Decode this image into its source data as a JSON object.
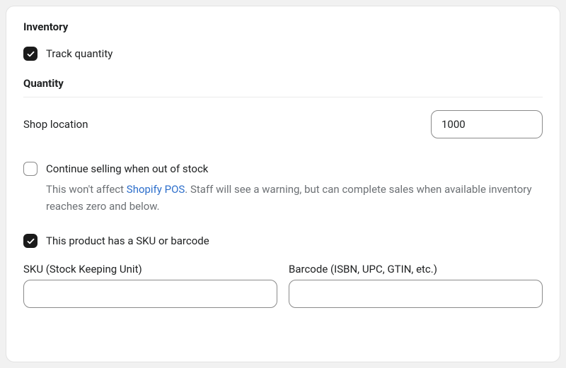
{
  "section": {
    "title": "Inventory",
    "track_quantity_label": "Track quantity",
    "quantity_title": "Quantity",
    "location_label": "Shop location",
    "location_quantity": "1000",
    "continue_selling_label": "Continue selling when out of stock",
    "continue_selling_helper_prefix": "This won't affect ",
    "continue_selling_link_text": "Shopify POS",
    "continue_selling_helper_suffix": ". Staff will see a warning, but can complete sales when available inventory reaches zero and below.",
    "sku_checkbox_label": "This product has a SKU or barcode",
    "sku_label": "SKU (Stock Keeping Unit)",
    "sku_value": "",
    "barcode_label": "Barcode (ISBN, UPC, GTIN, etc.)",
    "barcode_value": ""
  }
}
